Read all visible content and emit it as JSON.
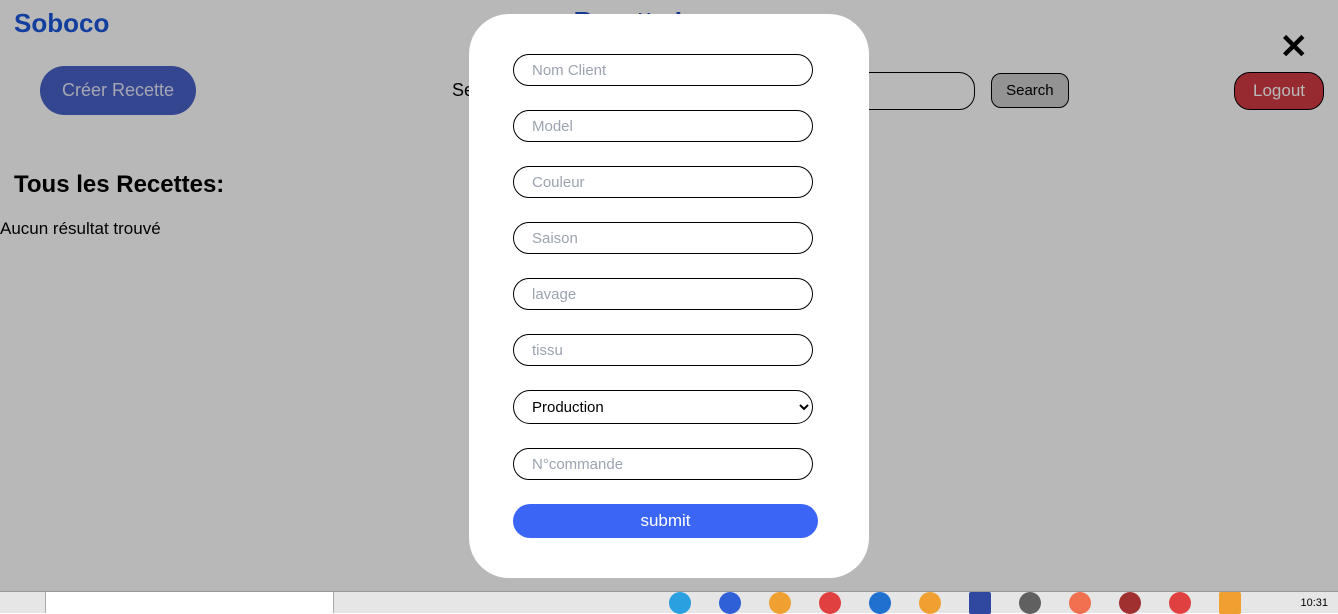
{
  "header": {
    "brand": "Soboco",
    "page_title": "Recette Lavage"
  },
  "toolbar": {
    "create_label": "Créer Recette",
    "search_label": "Search :",
    "search_button": "Search",
    "logout_label": "Logout"
  },
  "content": {
    "section_title": "Tous les Recettes:",
    "no_results": "Aucun résultat trouvé"
  },
  "modal": {
    "fields": {
      "nom_client": "Nom Client",
      "model": "Model",
      "couleur": "Couleur",
      "saison": "Saison",
      "lavage": "lavage",
      "tissu": "tissu",
      "ncommande": "N°commande"
    },
    "select_value": "Production",
    "submit_label": "submit"
  },
  "close_label": "✕",
  "taskbar": {
    "clock": "10:31",
    "icon_colors": [
      "#2aa0e0",
      "#3060d8",
      "#f0a030",
      "#e04040",
      "#2070d0",
      "#f0a030",
      "#3048a0",
      "#606060",
      "#f07050",
      "#a03030",
      "#e04040",
      "#f0a030"
    ]
  }
}
